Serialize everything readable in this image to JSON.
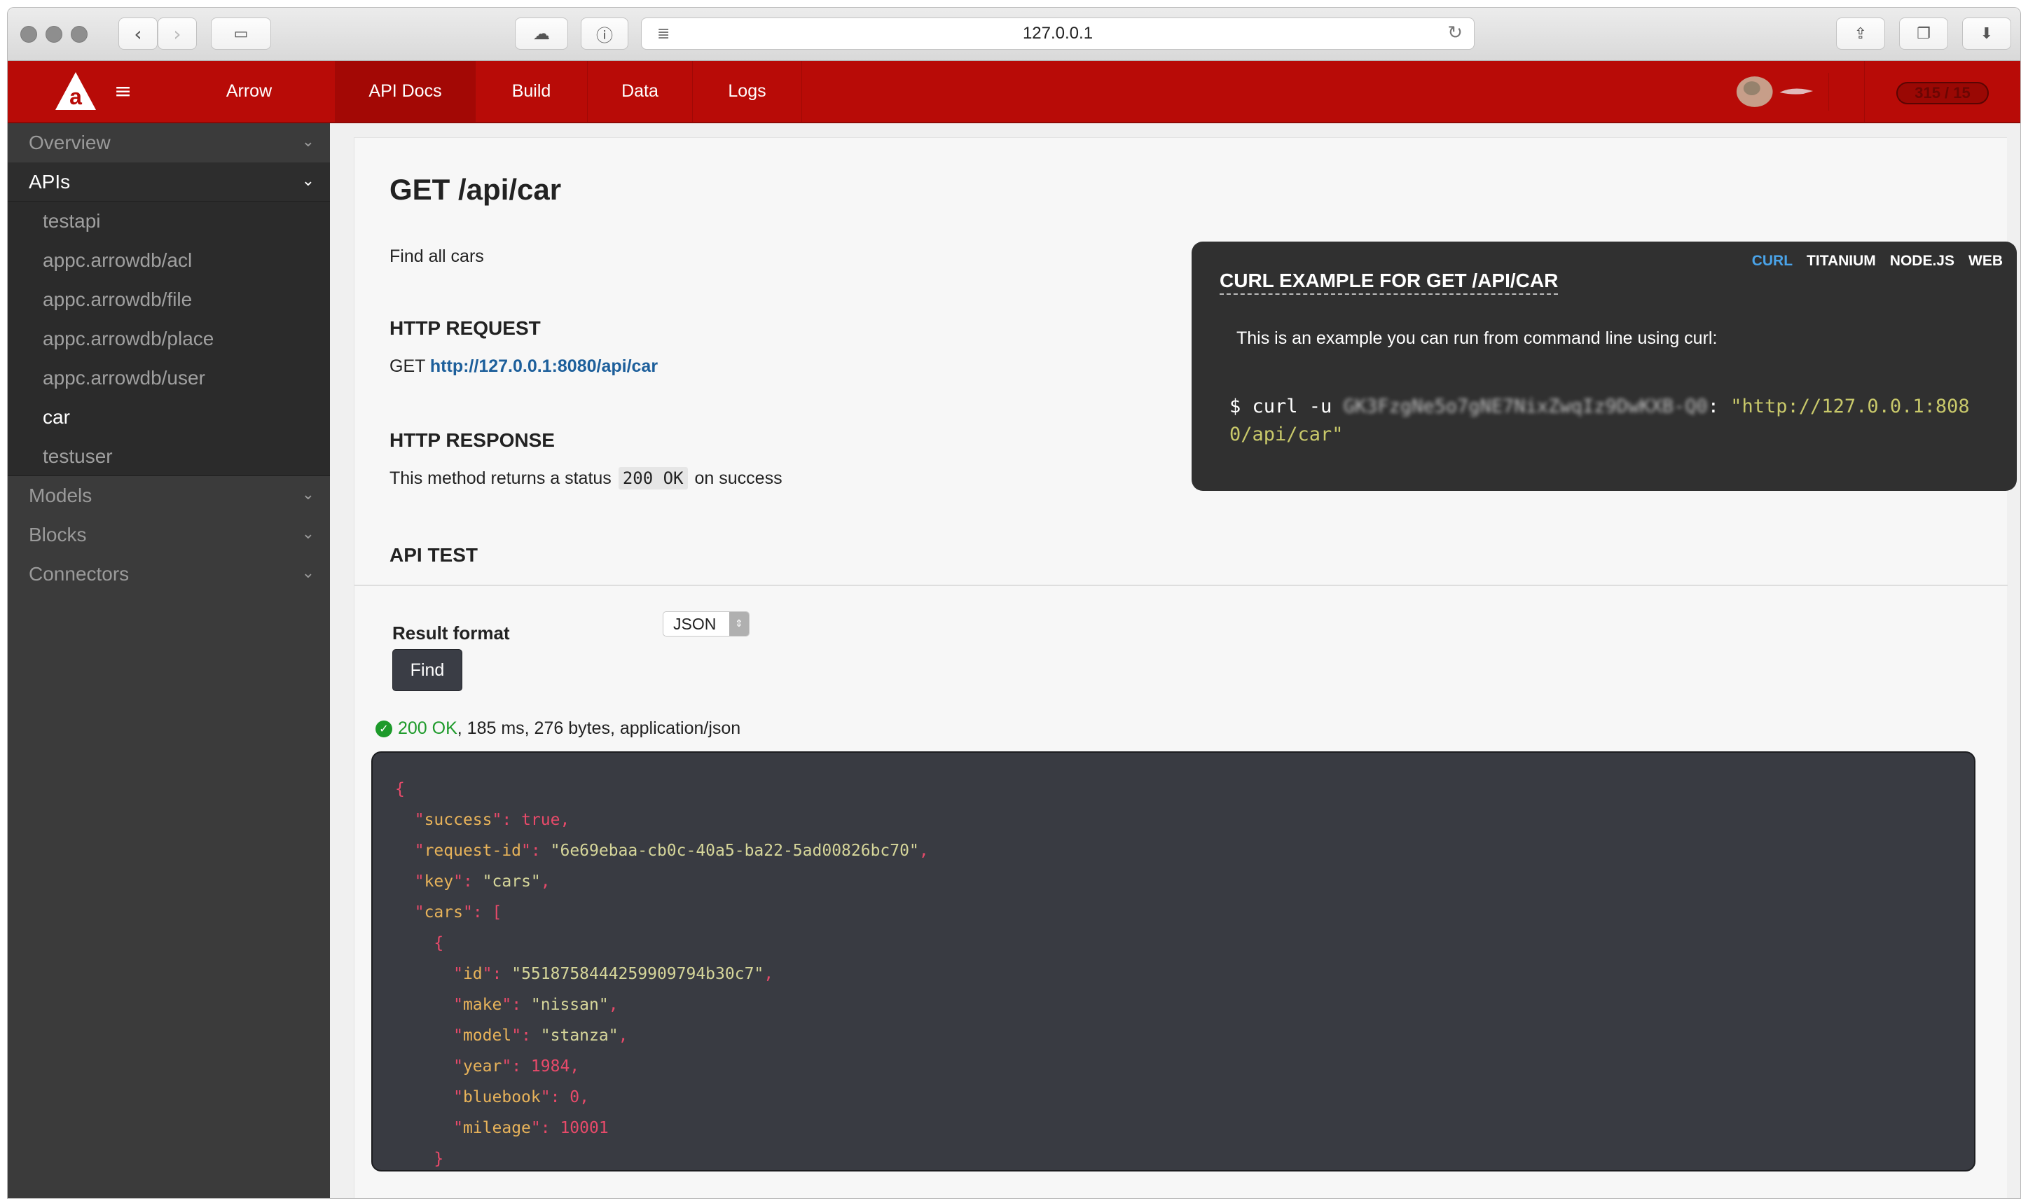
{
  "browser": {
    "url": "127.0.0.1"
  },
  "header": {
    "tabs": [
      "Arrow",
      "API Docs",
      "Build",
      "Data",
      "Logs"
    ],
    "active_tab": "API Docs",
    "usage_badge": "315 / 15"
  },
  "sidebar": {
    "sections": [
      {
        "label": "Overview",
        "expanded": false
      },
      {
        "label": "APIs",
        "expanded": true
      },
      {
        "label": "Models",
        "expanded": false
      },
      {
        "label": "Blocks",
        "expanded": false
      },
      {
        "label": "Connectors",
        "expanded": false
      }
    ],
    "api_items": [
      "testapi",
      "appc.arrowdb/acl",
      "appc.arrowdb/file",
      "appc.arrowdb/place",
      "appc.arrowdb/user",
      "car",
      "testuser"
    ],
    "active_item": "car"
  },
  "endpoint": {
    "title": "GET /api/car",
    "description": "Find all cars",
    "request_heading": "HTTP REQUEST",
    "request_method": "GET",
    "request_url": "http://127.0.0.1:8080/api/car",
    "response_heading": "HTTP RESPONSE",
    "response_prefix": "This method returns a status",
    "response_code": "200 OK",
    "response_suffix": "on success"
  },
  "curl_example": {
    "tabs": [
      "CURL",
      "TITANIUM",
      "NODE.JS",
      "WEB"
    ],
    "active_tab": "CURL",
    "title": "CURL EXAMPLE FOR GET /API/CAR",
    "description": "This is an example you can run from command line using curl:",
    "command_prefix": "$ curl -u",
    "api_key_obscured": "GK3FzgNe5o7gNE7NixZwqIz9DwKXB-Q0",
    "command_url": "\"http://127.0.0.1:8080/api/car\""
  },
  "api_test": {
    "heading": "API TEST",
    "result_format_label": "Result format",
    "result_format_value": "JSON",
    "find_button": "Find",
    "status_code": "200 OK",
    "status_rest": ", 185 ms, 276 bytes, application/json"
  },
  "response_json": {
    "success": "true",
    "request_id": "6e69ebaa-cb0c-40a5-ba22-5ad00826bc70",
    "key": "cars",
    "car": {
      "id": "5518758444259909794b30c7",
      "make": "nissan",
      "model": "stanza",
      "year": "1984",
      "bluebook": "0",
      "mileage": "10001"
    }
  },
  "colors": {
    "brand_red": "#b80b07",
    "link_blue": "#1d5f9b",
    "success_green": "#1d9a2a"
  }
}
